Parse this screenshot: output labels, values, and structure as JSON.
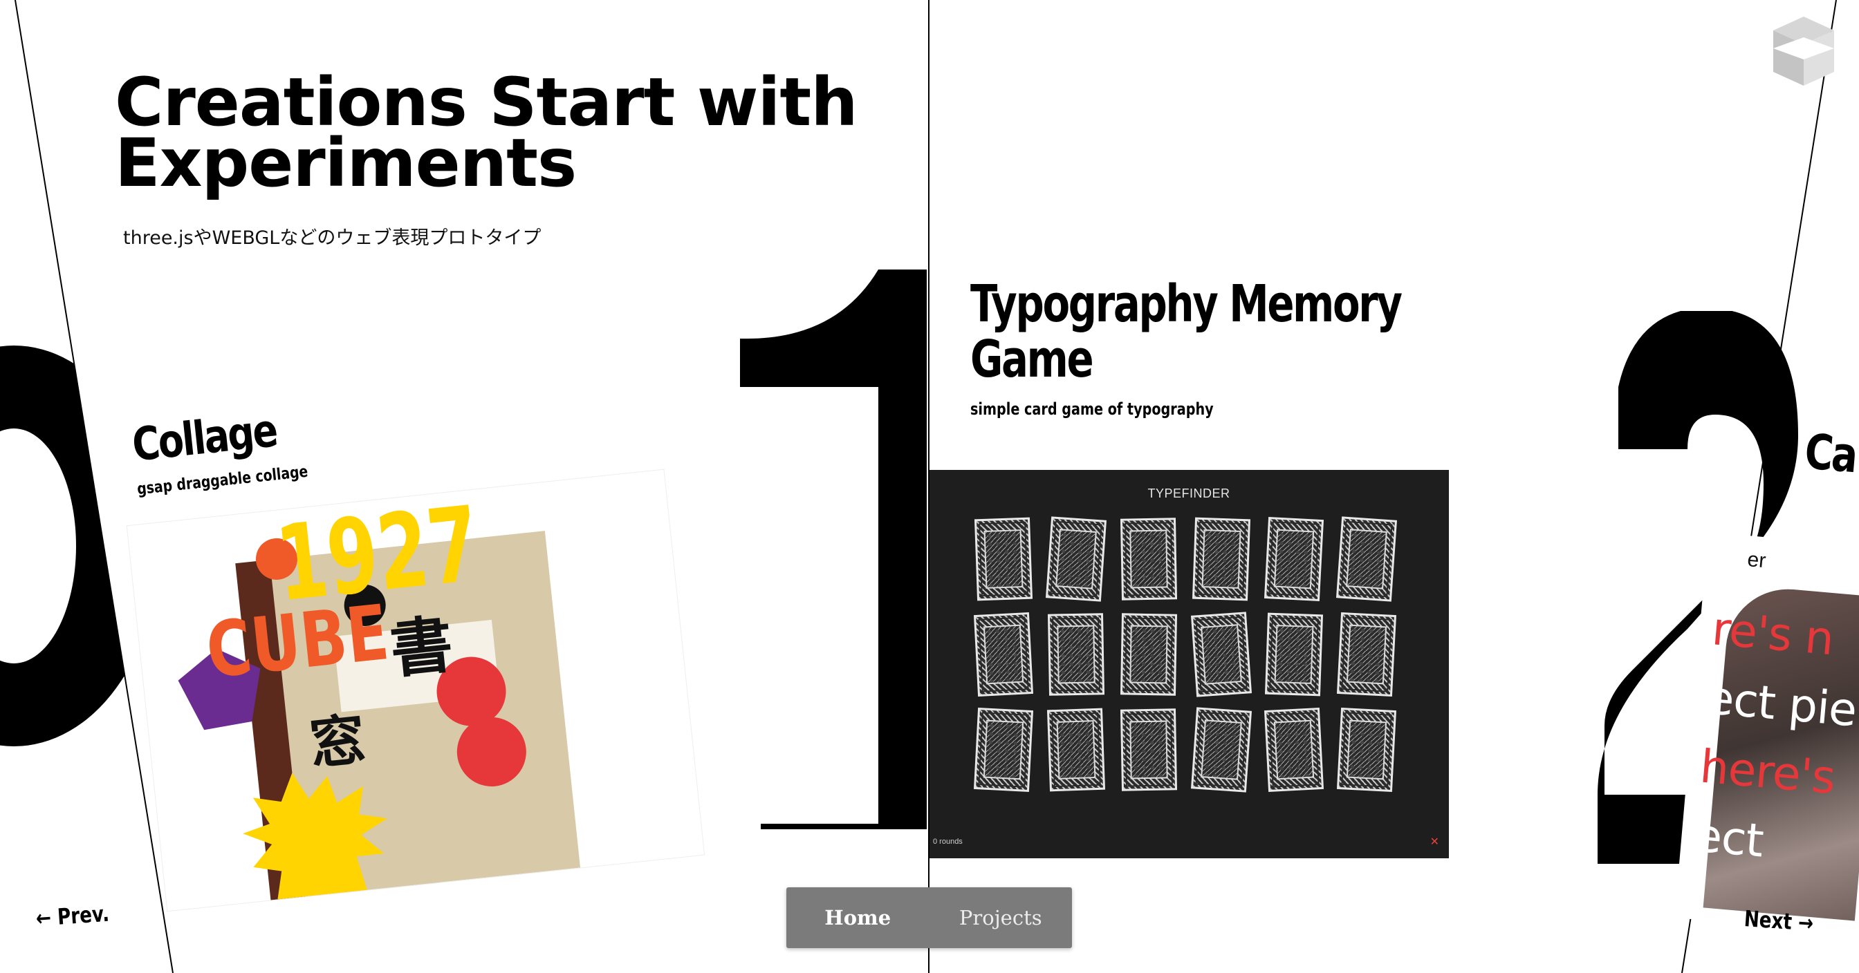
{
  "hero": {
    "title_line1": "Creations Start with",
    "title_line2": "Experiments",
    "subtitle": "three.jsやWEBGLなどのウェブ表現プロトタイプ"
  },
  "cards": {
    "collage": {
      "title": "Collage",
      "subtitle": "gsap draggable collage",
      "image_text_1927": "1927",
      "image_text_cube": "CUBE",
      "image_kanji_1": "書",
      "image_kanji_2": "窓"
    },
    "memory": {
      "title_line1": "Typography Memory",
      "title_line2": "Game",
      "subtitle": "simple card game of typography",
      "game_title": "TYPEFINDER",
      "rounds_label": "0 rounds",
      "close_symbol": "✕"
    },
    "right": {
      "title": "Ca",
      "label": "er",
      "line1": "re's n",
      "line2": "ect pie",
      "line3": "here's",
      "line4": "ect"
    }
  },
  "nav": {
    "prev": "← Prev.",
    "next": "Next →"
  },
  "tabs": {
    "home": "Home",
    "projects": "Projects"
  },
  "icons": {
    "logo": "cube-logo-icon"
  },
  "colors": {
    "accent_red": "#e6373a",
    "yellow": "#ffd400",
    "orange": "#f05a28",
    "purple": "#6a2c91",
    "game_bg": "#1e1e1e",
    "tabbar_bg": "#7b7b7b"
  }
}
